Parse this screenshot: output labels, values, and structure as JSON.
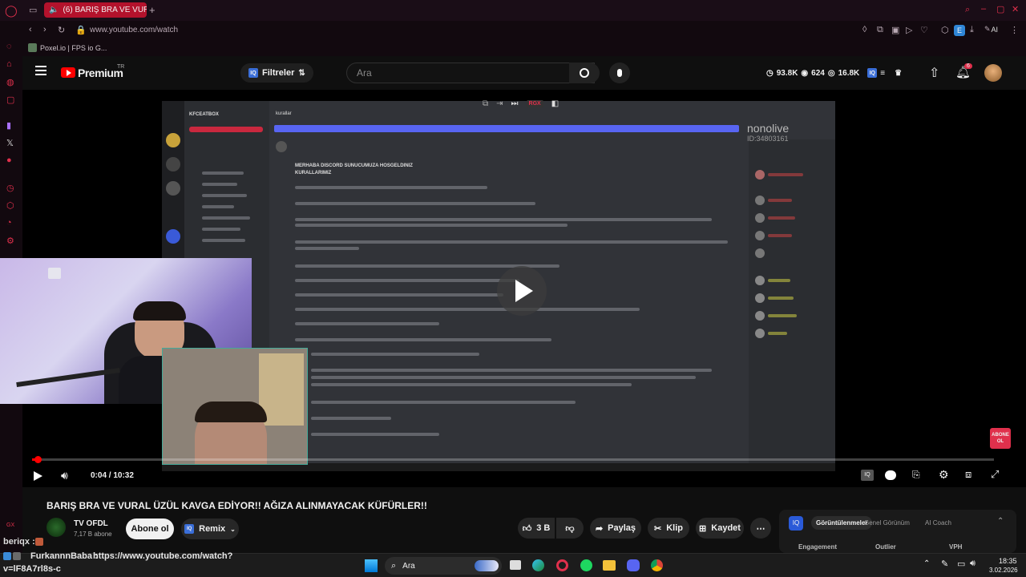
{
  "browser": {
    "tab_title": "(6) BARIŞ BRA VE VURA",
    "url": "www.youtube.com/watch",
    "bookmark": "Poxel.io | FPS io G...",
    "ext_badge": "E",
    "ai_label": "AI"
  },
  "youtube": {
    "logo": "Premium",
    "logo_sup": "TR",
    "filters_label": "Filtreler",
    "search_placeholder": "Ara",
    "stats": {
      "views": "93.8K",
      "likes": "624",
      "comments": "16.8K"
    },
    "notifications": "6"
  },
  "player": {
    "time": "0:04 / 10:32",
    "progress": 0.006,
    "overlay_brand": "nonolive",
    "overlay_id": "ID:34803161",
    "subscribe_badge": [
      "ABONE",
      "OL"
    ],
    "ext_rgx": "RGX"
  },
  "discord": {
    "server": "KFCEATBOX",
    "channel": "kurallar",
    "heading_1": "MERHABA DISCORD SUNUCUMUZA HOSGELDINIZ",
    "heading_2": "KURALLARIMIZ"
  },
  "video": {
    "title": "BARIŞ BRA VE VURAL ÜZÜL KAVGA EDİYOR!! AĞIZA ALINMAYACAK KÜFÜRLER!!",
    "channel": "TV OFDL",
    "subs": "7,17 B abone",
    "subscribe": "Abone ol",
    "remix": "Remix",
    "likes": "3 B",
    "share": "Paylaş",
    "clip": "Klip",
    "save": "Kaydet"
  },
  "panel": {
    "tabs": [
      "Görüntülenmeler",
      "Genel Görünüm",
      "AI Coach"
    ],
    "cols": [
      "Engagement",
      "Outlier",
      "VPH"
    ]
  },
  "chat": [
    {
      "user": "beriqx :",
      "text": ""
    },
    {
      "user": "FurkannnBaba :",
      "text": "https://www.youtube.com/watch?"
    },
    {
      "user": "",
      "text": "v=lF8A7rl8s-c"
    }
  ],
  "chat_badge": "GX",
  "taskbar": {
    "search": "Ara",
    "time": "18:35",
    "date": "3.02.2026"
  }
}
